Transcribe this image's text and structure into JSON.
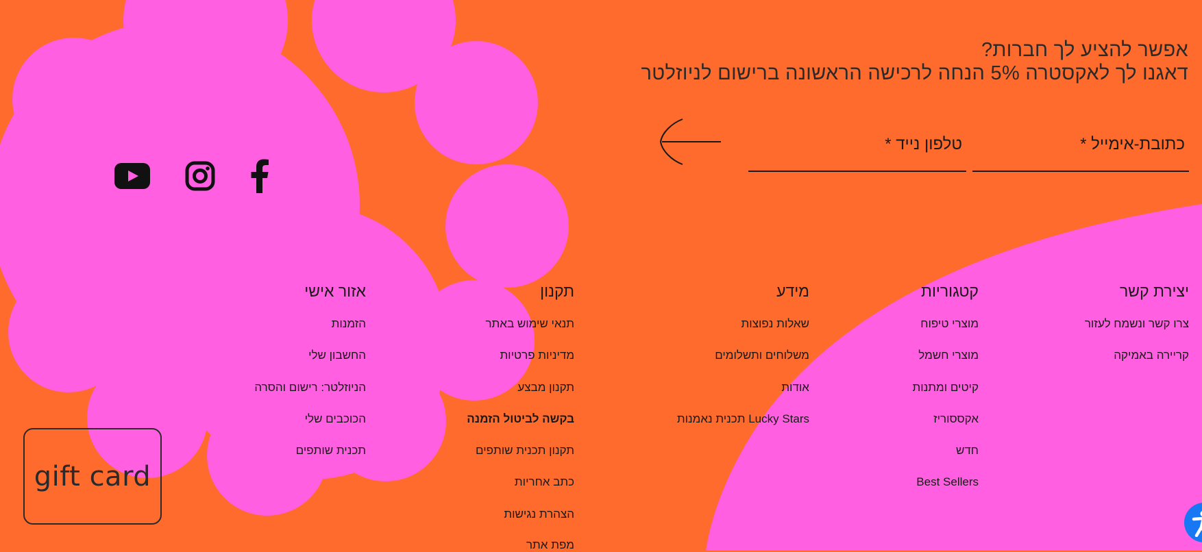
{
  "newsletter": {
    "heading": "אפשר להציע לך חברות?",
    "subheading": "דאגנו לך לאקסטרה 5% הנחה לרכישה הראשונה ברישום לניוזלטר",
    "email_label": "כתובת-אימייל *",
    "phone_label": "טלפון נייד *",
    "email_placeholder": "",
    "phone_placeholder": ""
  },
  "social": [
    "youtube-icon",
    "instagram-icon",
    "facebook-icon"
  ],
  "columns": [
    {
      "title": "יצירת קשר",
      "links": [
        "צרו קשר ונשמח לעזור",
        "קריירה באמיקה"
      ]
    },
    {
      "title": "קטגוריות",
      "links": [
        "מוצרי טיפוח",
        "מוצרי חשמל",
        "קיטים ומתנות",
        "אקססוריז",
        "חדש",
        "Best Sellers"
      ]
    },
    {
      "title": "מידע",
      "links": [
        "שאלות נפוצות",
        "משלוחים ותשלומים",
        "אודות",
        "Lucky Stars תכנית נאמנות"
      ]
    },
    {
      "title": "תקנון",
      "links": [
        "תנאי שימוש באתר",
        "מדיניות פרטיות",
        "תקנון מבצע",
        "בקשה לביטול הזמנה",
        "תקנון תכנית שותפים",
        "כתב אחריות",
        "הצהרת נגישות",
        "מפת אתר"
      ]
    },
    {
      "title": "אזור אישי",
      "links": [
        "הזמנות",
        "החשבון שלי",
        "הניוזלטר: רישום והסרה",
        "הכוכבים שלי",
        "תכנית שותפים"
      ]
    }
  ],
  "gift_card": {
    "label": "gift card"
  },
  "colors": {
    "background": "#FF6B2C",
    "pink": "#FF5FE0",
    "text": "#1a1a1a",
    "accessibility": "#1877F2"
  }
}
